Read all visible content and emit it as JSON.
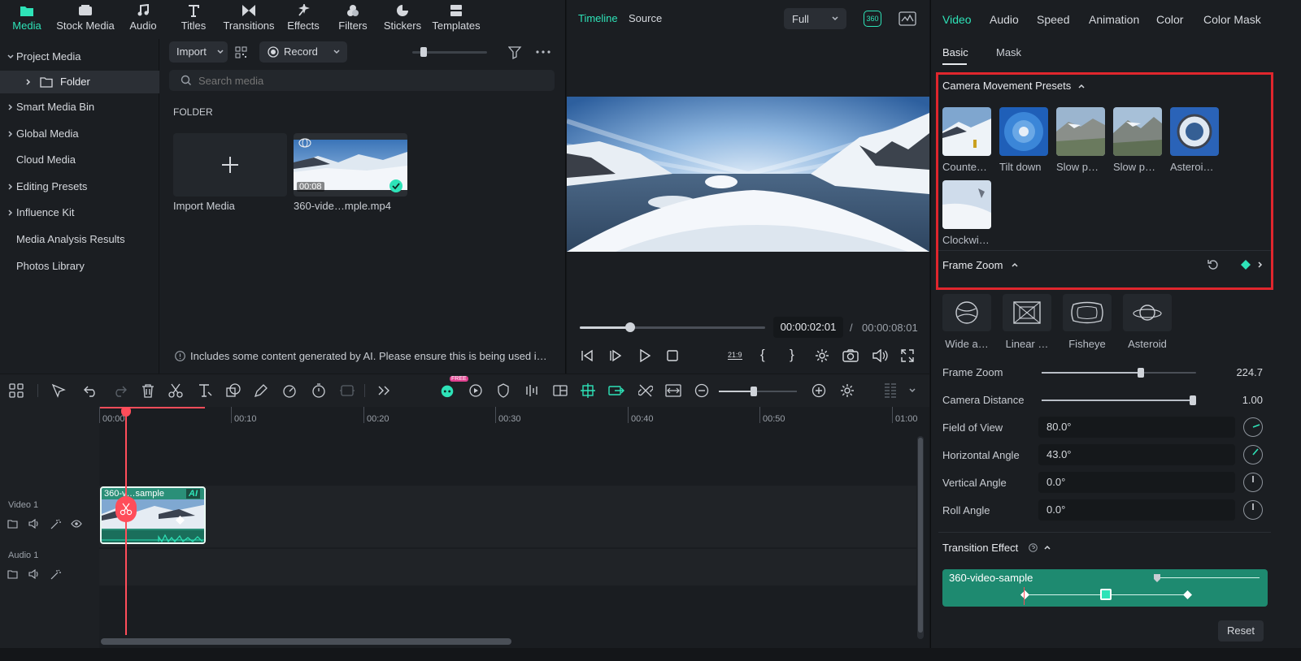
{
  "media_tabs": [
    {
      "label": "Media",
      "icon": "media-folder-icon",
      "active": true
    },
    {
      "label": "Stock Media",
      "icon": "stock-media-icon"
    },
    {
      "label": "Audio",
      "icon": "music-note-icon"
    },
    {
      "label": "Titles",
      "icon": "titles-T-icon"
    },
    {
      "label": "Transitions",
      "icon": "transitions-bowtie-icon"
    },
    {
      "label": "Effects",
      "icon": "effects-sparkle-icon"
    },
    {
      "label": "Filters",
      "icon": "filters-circles-icon"
    },
    {
      "label": "Stickers",
      "icon": "stickers-icon"
    },
    {
      "label": "Templates",
      "icon": "templates-icon"
    }
  ],
  "sidebar": {
    "items": [
      {
        "label": "Project Media",
        "expanded": true
      },
      {
        "label": "Folder",
        "selected": true
      },
      {
        "label": "Smart Media Bin"
      },
      {
        "label": "Global Media"
      },
      {
        "label": "Cloud Media"
      },
      {
        "label": "Editing Presets"
      },
      {
        "label": "Influence Kit"
      },
      {
        "label": "Media Analysis Results"
      },
      {
        "label": "Photos Library"
      }
    ]
  },
  "browser": {
    "import_label": "Import",
    "record_label": "Record",
    "search_placeholder": "Search media",
    "section_title": "FOLDER",
    "import_media_label": "Import Media",
    "clip": {
      "name": "360-vide…mple.mp4",
      "duration": "00:08"
    },
    "ai_notice": "Includes some content generated by AI. Please ensure this is being used i…"
  },
  "player": {
    "tab_timeline": "Timeline",
    "tab_source": "Source",
    "quality": "Full",
    "badge_360": "360",
    "current_time": "00:00:02:01",
    "separator": "/",
    "total_time": "00:00:08:01",
    "progress_fraction": 0.27,
    "aspect_label": "21:9"
  },
  "inspector": {
    "tabs": [
      "Video",
      "Audio",
      "Speed",
      "Animation",
      "Color",
      "Color Mask"
    ],
    "subtabs": [
      "Basic",
      "Mask"
    ],
    "camera_presets_title": "Camera Movement Presets",
    "presets": [
      "Counte…",
      "Tilt down",
      "Slow p…",
      "Slow p…",
      "Asteroi…",
      "Clockwi…"
    ],
    "frame_zoom_title": "Frame Zoom",
    "lenses": [
      "Wide a…",
      "Linear …",
      "Fisheye",
      "Asteroid"
    ],
    "frame_zoom": {
      "label": "Frame Zoom",
      "value": "224.7",
      "fraction": 0.64
    },
    "camera_distance": {
      "label": "Camera Distance",
      "value": "1.00",
      "fraction": 0.98
    },
    "fov": {
      "label": "Field of View",
      "value": "80.0°"
    },
    "h_angle": {
      "label": "Horizontal Angle",
      "value": "43.0°"
    },
    "v_angle": {
      "label": "Vertical Angle",
      "value": "0.0°"
    },
    "roll": {
      "label": "Roll Angle",
      "value": "0.0°"
    },
    "transition_title": "Transition Effect",
    "transition_clip": "360-video-sample",
    "reset_label": "Reset"
  },
  "timeline": {
    "ticks": [
      "00:00",
      "00:10",
      "00:20",
      "00:30",
      "00:40",
      "00:50",
      "01:00"
    ],
    "video_track": "Video 1",
    "audio_track": "Audio 1",
    "clip_label": "360-v…sample",
    "clip_badge": "AI",
    "free_badge": "FREE"
  },
  "colors": {
    "accent": "#2ee3b8",
    "highlight_box": "#e0262d",
    "playhead": "#ff4d5a",
    "clip": "#2a8f78"
  }
}
